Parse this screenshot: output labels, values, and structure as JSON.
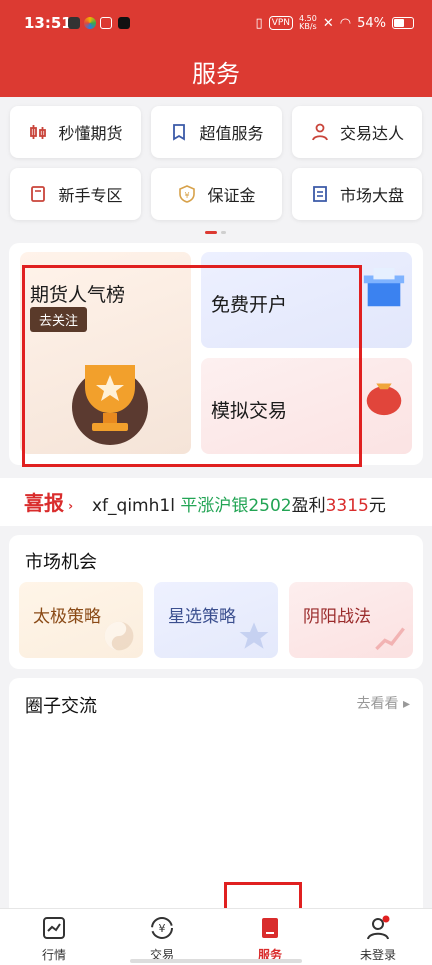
{
  "status_bar": {
    "time": "13:51",
    "vpn": "VPN",
    "speed_value": "4.50",
    "speed_unit": "KB/s",
    "battery": "54%"
  },
  "header": {
    "title": "服务"
  },
  "shortcuts": [
    {
      "label": "秒懂期货",
      "icon": "candlestick-icon"
    },
    {
      "label": "超值服务",
      "icon": "bookmark-icon"
    },
    {
      "label": "交易达人",
      "icon": "person-icon"
    },
    {
      "label": "新手专区",
      "icon": "book-icon"
    },
    {
      "label": "保证金",
      "icon": "yen-shield-icon"
    },
    {
      "label": "市场大盘",
      "icon": "document-icon"
    }
  ],
  "promo": {
    "rank_title": "期货人气榜",
    "rank_button": "去关注",
    "open_account": "免费开户",
    "simulated_trade": "模拟交易"
  },
  "ticker": {
    "tag": "喜报",
    "user": "xf_qimh1l",
    "action": "平涨沪银2502",
    "profit_label": "盈利",
    "profit_value": "3315",
    "unit": "元"
  },
  "market": {
    "title": "市场机会",
    "cards": [
      "太极策略",
      "星选策略",
      "阴阳战法"
    ]
  },
  "circle": {
    "title": "圈子交流",
    "more": "去看看"
  },
  "bottom_nav": [
    {
      "label": "行情"
    },
    {
      "label": "交易"
    },
    {
      "label": "服务"
    },
    {
      "label": "未登录"
    }
  ],
  "colors": {
    "brand_red": "#dc3a32",
    "profit_green": "#22a454"
  }
}
